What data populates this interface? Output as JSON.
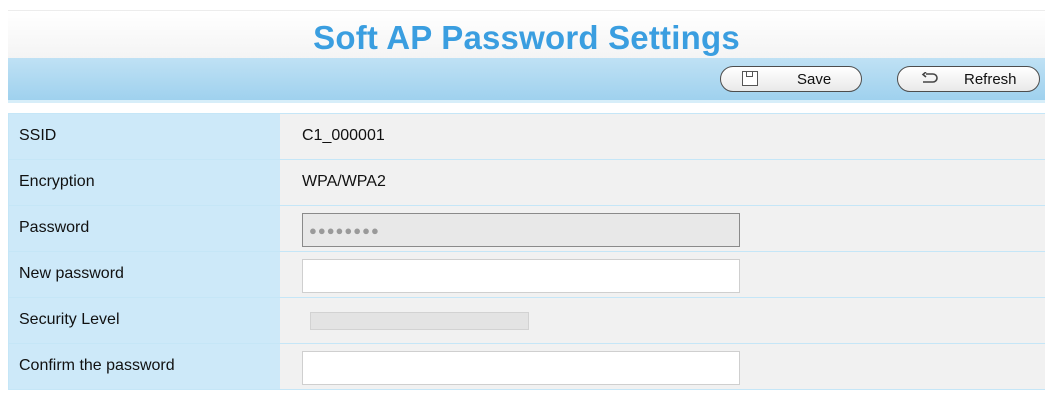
{
  "page": {
    "title": "Soft AP Password Settings"
  },
  "toolbar": {
    "save_label": "Save",
    "save_icon": "save-icon",
    "refresh_label": "Refresh",
    "refresh_icon": "refresh-icon"
  },
  "form": {
    "ssid": {
      "label": "SSID",
      "value": "C1_000001"
    },
    "encryption": {
      "label": "Encryption",
      "value": "WPA/WPA2"
    },
    "password": {
      "label": "Password",
      "value": "●●●●●●●●"
    },
    "new_password": {
      "label": "New password",
      "value": ""
    },
    "security_level": {
      "label": "Security Level",
      "level": 0
    },
    "confirm_password": {
      "label": "Confirm the password",
      "value": ""
    }
  },
  "colors": {
    "title": "#3a9ee0",
    "toolbar": "#b3dbf2",
    "label_bg": "#cde9f9",
    "value_bg": "#f1f1f1"
  }
}
